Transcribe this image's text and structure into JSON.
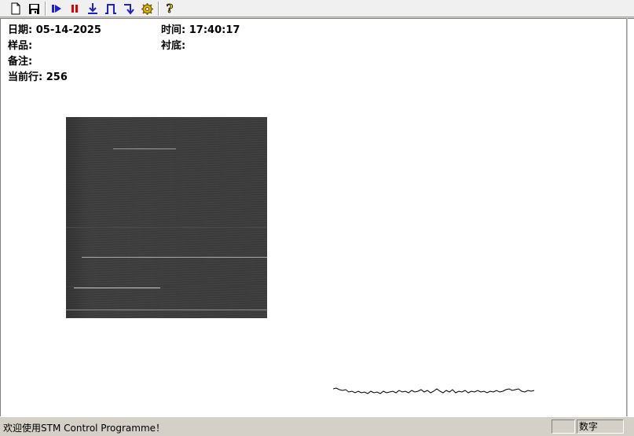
{
  "toolbar": {
    "buttons": [
      {
        "name": "new-document-icon"
      },
      {
        "name": "save-icon"
      },
      {
        "name": "start-scan-icon"
      },
      {
        "name": "pause-icon"
      },
      {
        "name": "approach-down-icon"
      },
      {
        "name": "pulse-icon"
      },
      {
        "name": "retract-icon"
      },
      {
        "name": "settings-icon"
      },
      {
        "name": "help-icon"
      }
    ]
  },
  "info": {
    "date_label": "日期:",
    "date_value": "05-14-2025",
    "time_label": "时间:",
    "time_value": "17:40:17",
    "sample_label": "样品:",
    "sample_value": "",
    "substrate_label": "衬底:",
    "substrate_value": "",
    "notes_label": "备注:",
    "notes_value": "",
    "current_row_label": "当前行:",
    "current_row_value": "256"
  },
  "status": {
    "message": "欢迎使用STM Control Programme！",
    "pane_1": "",
    "pane_2": "数字"
  },
  "colors": {
    "accent_blue": "#1f1fd0",
    "pause_red": "#e00000"
  }
}
